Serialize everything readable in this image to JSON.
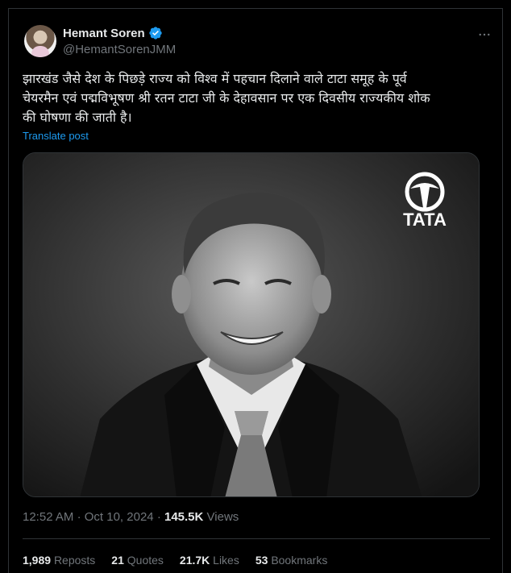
{
  "author": {
    "name": "Hemant Soren",
    "handle": "@HemantSorenJMM",
    "verified": true
  },
  "post": {
    "text": "झारखंड जैसे देश के पिछड़े राज्य को विश्व में पहचान दिलाने वाले टाटा समूह के पूर्व\nचेयरमैन एवं पद्मविभूषण श्री रतन टाटा जी के देहावसान पर एक दिवसीय राज्यकीय शोक\nकी घोषणा की जाती है।",
    "translate_label": "Translate post"
  },
  "media": {
    "logo_text": "TATA",
    "style": "black-and-white portrait"
  },
  "meta": {
    "time": "12:52 AM",
    "date": "Oct 10, 2024",
    "views_count": "145.5K",
    "views_label": "Views"
  },
  "stats": {
    "reposts_count": "1,989",
    "reposts_label": "Reposts",
    "quotes_count": "21",
    "quotes_label": "Quotes",
    "likes_count": "21.7K",
    "likes_label": "Likes",
    "bookmarks_count": "53",
    "bookmarks_label": "Bookmarks"
  },
  "colors": {
    "background": "#000000",
    "text": "#e7e9ea",
    "muted": "#71767b",
    "accent": "#1d9bf0",
    "border": "#2f3336"
  },
  "icons": {
    "verified": "verified-badge-icon",
    "more": "more-horizontal-icon",
    "logo": "tata-logo-icon"
  }
}
